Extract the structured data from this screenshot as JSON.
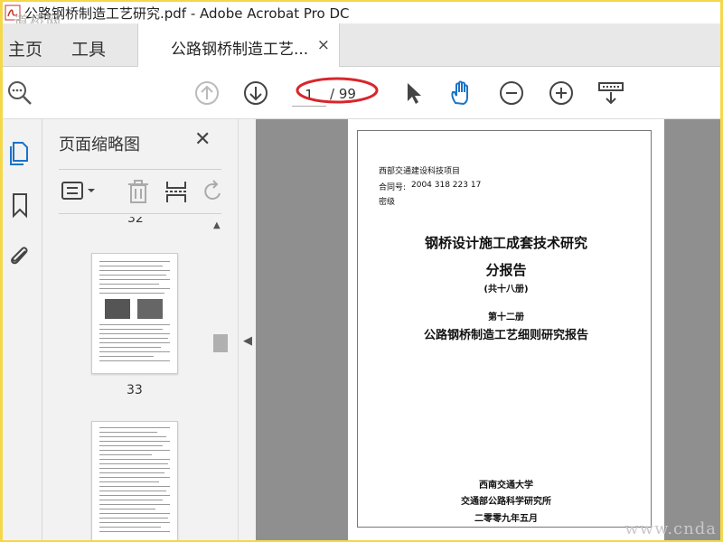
{
  "window": {
    "title": "公路钢桥制造工艺研究.pdf - Adobe Acrobat Pro DC",
    "watermark_top": "道桥网",
    "watermark_bottom": "www.cnda"
  },
  "tabs": {
    "home": "主页",
    "tools": "工具",
    "document": "公路钢桥制造工艺...",
    "close_symbol": "×"
  },
  "toolbar": {
    "current_page": "1",
    "total_pages": "/ 99",
    "icons": [
      "search-icon",
      "page-up-icon",
      "page-down-icon",
      "select-arrow-icon",
      "hand-tool-icon",
      "zoom-out-icon",
      "zoom-in-icon",
      "read-mode-icon"
    ]
  },
  "rail": {
    "icons": [
      "page-thumbnails-icon",
      "bookmark-icon",
      "attachment-icon"
    ]
  },
  "thumbnail_panel": {
    "title": "页面缩略图",
    "close_symbol": "✕",
    "tool_icons": [
      "thumbnail-options-icon",
      "delete-page-icon",
      "insert-page-icon",
      "rotate-page-icon"
    ],
    "pages": [
      {
        "number": "32"
      },
      {
        "number": "33"
      }
    ]
  },
  "document_page": {
    "header_line1": "西部交通建设科技项目",
    "contract_label": "合同号:",
    "contract_number": "2004 318 223 17",
    "secret_level": "密级",
    "main_title": "钢桥设计施工成套技术研究",
    "sub_title": "分报告",
    "volume_count": "(共十八册)",
    "volume_no": "第十二册",
    "report_title": "公路钢桥制造工艺细则研究报告",
    "org1": "西南交通大学",
    "org2": "交通部公路科学研究所",
    "date": "二零零九年五月"
  },
  "colors": {
    "frame": "#f4d84a",
    "accent_blue": "#1a73c8",
    "annotation_red": "#d8262b",
    "viewport_gray": "#8f8f8f"
  }
}
